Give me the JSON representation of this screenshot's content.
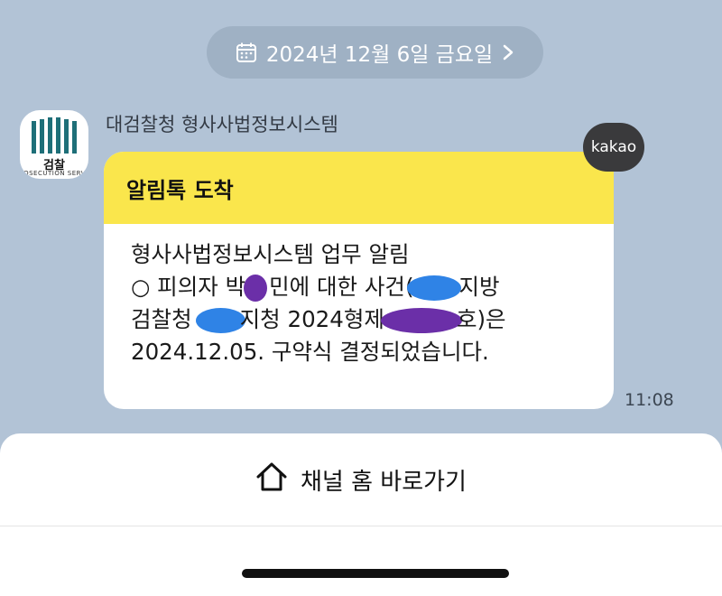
{
  "date_bar": {
    "label": "2024년 12월 6일 금요일",
    "icon": "calendar-icon",
    "chevron": "chevron-right-icon"
  },
  "channel": {
    "name": "대검찰청 형사사법정보시스템",
    "avatar_text": "검찰",
    "avatar_subtext": "PROSECUTION SERVICE"
  },
  "badge": {
    "label": "kakao"
  },
  "message": {
    "header": "알림톡 도착",
    "lines": [
      "형사사법정보시스템 업무 알림",
      "○ 피의자 박 민에 대한 사건( 지방",
      "검찰청 지청 2024형제 호)은",
      "2024.12.05. 구약식 결정되었습니다."
    ],
    "parts": {
      "l1": "형사사법정보시스템 업무 알림",
      "l2a": "○ 피의자 박",
      "l2b": "민에 대한 사건(",
      "l2c": "지방",
      "l3a": "검찰청",
      "l3b": "지청 2024형제",
      "l3c": "호)은",
      "l4": "2024.12.05. 구약식 결정되었습니다."
    },
    "time": "11:08"
  },
  "bottom_sheet": {
    "home_link": "채널 홈 바로가기",
    "icon": "home-icon"
  },
  "colors": {
    "background": "#b2c3d6",
    "pill": "#9fb1c4",
    "header_yellow": "#fae64c",
    "redact_purple": "#6b2fa8",
    "redact_blue": "#2f83e6"
  }
}
